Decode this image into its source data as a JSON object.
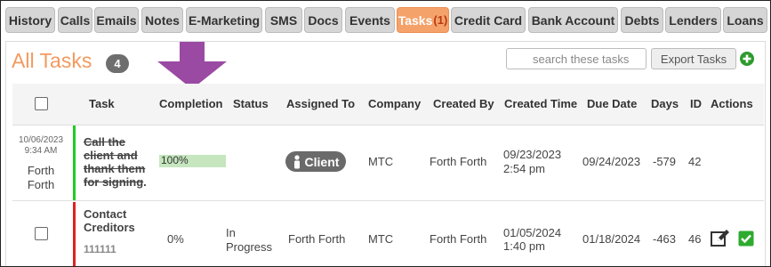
{
  "tabs": [
    {
      "label": "History"
    },
    {
      "label": "Calls"
    },
    {
      "label": "Emails"
    },
    {
      "label": "Notes"
    },
    {
      "label": "E-Marketing"
    },
    {
      "label": "SMS"
    },
    {
      "label": "Docs"
    },
    {
      "label": "Events"
    },
    {
      "label": "Tasks",
      "count": "(1)",
      "active": true
    },
    {
      "label": "Credit Card"
    },
    {
      "label": "Bank Account"
    },
    {
      "label": "Debts"
    },
    {
      "label": "Lenders"
    },
    {
      "label": "Loans"
    }
  ],
  "header": {
    "title": "All Tasks",
    "count": "4",
    "search_placeholder": "search these tasks",
    "export_label": "Export Tasks"
  },
  "columns": [
    "Task",
    "Completion",
    "Status",
    "Assigned To",
    "Company",
    "Created By",
    "Created Time",
    "Due Date",
    "Days",
    "ID",
    "Actions"
  ],
  "rows": [
    {
      "completed_date": "10/06/2023",
      "completed_time": "9:34 AM",
      "completed_by_1": "Forth",
      "completed_by_2": "Forth",
      "task_lines": [
        "Call the",
        "client and",
        "thank them",
        "for signing"
      ],
      "task_suffix": ".",
      "completion": "100%",
      "completion_fraction": 1.0,
      "status": "",
      "assigned_to": "Client",
      "company": "MTC",
      "created_by": "Forth Forth",
      "created_date": "09/23/2023",
      "created_time": "2:54 pm",
      "due_date": "09/24/2023",
      "days": "-579",
      "id": "42",
      "bar_color": "#22cc22"
    },
    {
      "task_lines": [
        "Contact",
        "Creditors"
      ],
      "task_sub": "111111",
      "completion": "0%",
      "completion_fraction": 0.0,
      "status_1": "In",
      "status_2": "Progress",
      "assigned_to": "Forth Forth",
      "company": "MTC",
      "created_by": "Forth Forth",
      "created_date": "01/05/2024",
      "created_time": "1:40 pm",
      "due_date": "01/18/2024",
      "days": "-463",
      "id": "46",
      "bar_color": "#dd2222"
    }
  ],
  "colors": {
    "accent": "#f39a5f",
    "active_tab": "#f5a26a",
    "annotation_arrow": "#9a4aa3",
    "add_green": "#2e9a2e",
    "check_green": "#2eaa2e"
  },
  "icons": [
    "search-icon",
    "add-icon",
    "client-person-icon",
    "edit-icon",
    "check-icon",
    "arrow-annotation"
  ]
}
